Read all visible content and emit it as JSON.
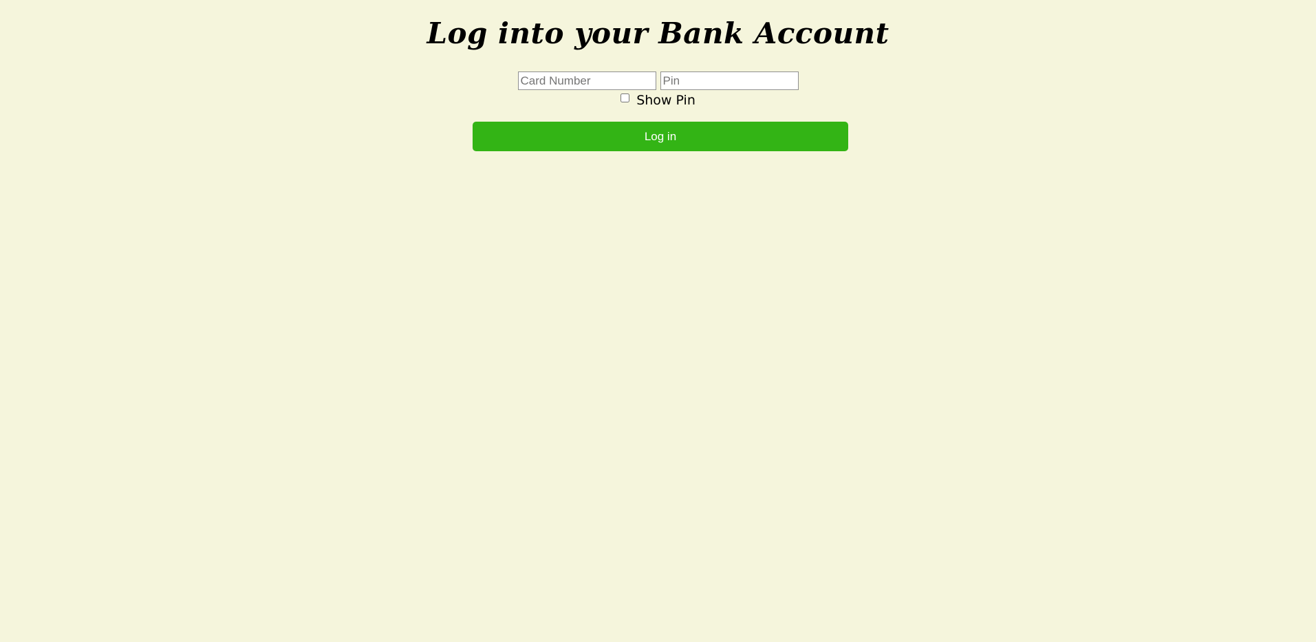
{
  "page": {
    "title": "Log into your Bank Account",
    "background_color": "#f5f5dc"
  },
  "form": {
    "card_number": {
      "value": "",
      "placeholder": "Card Number"
    },
    "pin": {
      "value": "",
      "placeholder": "Pin"
    },
    "show_pin": {
      "label": "Show Pin",
      "checked": false
    },
    "login_button": {
      "label": "Log in",
      "color": "#33b415"
    }
  }
}
